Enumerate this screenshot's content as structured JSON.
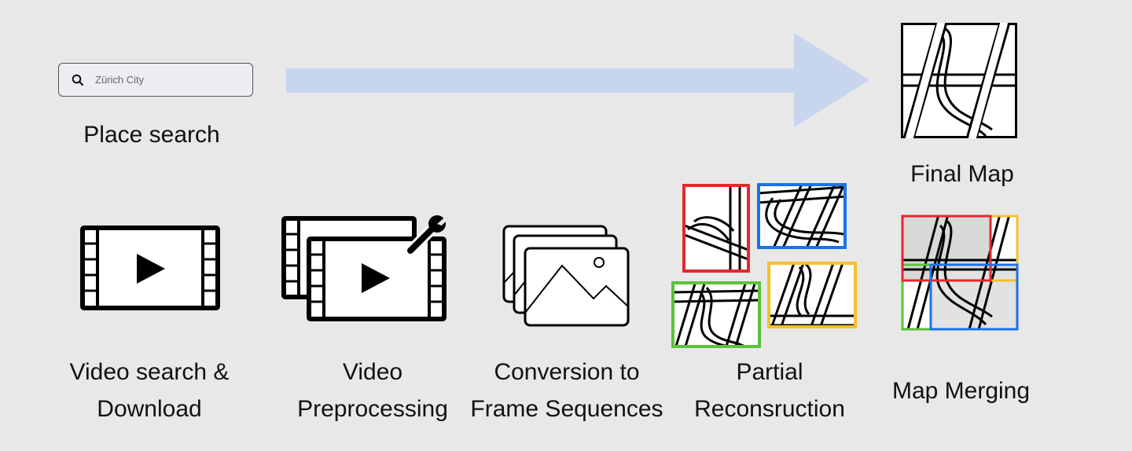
{
  "search": {
    "value": "Zürich City"
  },
  "labels": {
    "place_search": "Place search",
    "final_map": "Final Map",
    "video_search_line1": "Video search &",
    "video_search_line2": "Download",
    "video_pre_line1": "Video",
    "video_pre_line2": "Preprocessing",
    "conversion_line1": "Conversion to",
    "conversion_line2": "Frame Sequences",
    "partial_line1": "Partial",
    "partial_line2": "Reconsruction",
    "map_merging": "Map Merging"
  },
  "colors": {
    "background": "#e8e8e8",
    "arrow": "#c7d5ee",
    "red": "#e8262b",
    "blue": "#1a73e8",
    "yellow": "#f5c12a",
    "green": "#5cc13b"
  }
}
